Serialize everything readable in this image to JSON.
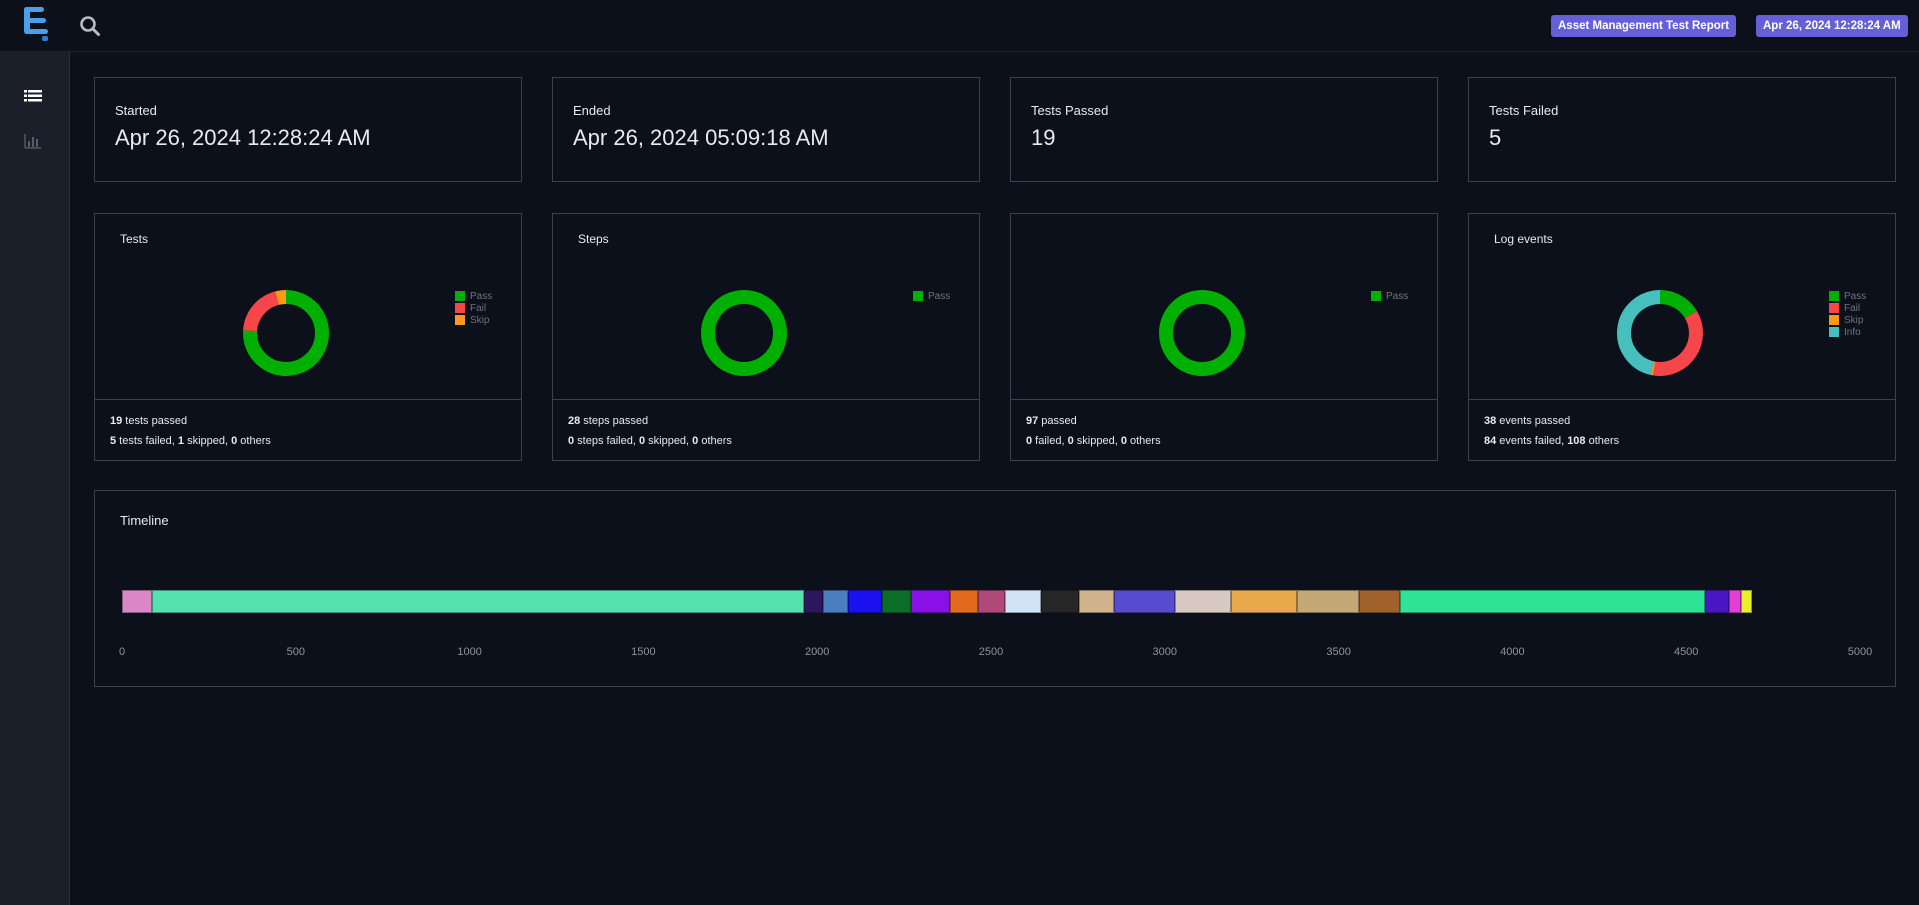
{
  "header": {
    "report_name": "Asset Management Test Report",
    "report_date": "Apr 26, 2024 12:28:24 AM",
    "logo_icon": "extent-logo-icon",
    "search_icon": "search-icon"
  },
  "sidebar": {
    "items": [
      {
        "icon": "list-icon"
      },
      {
        "icon": "bar-chart-icon"
      }
    ]
  },
  "summary_cards": {
    "started": {
      "label": "Started",
      "value": "Apr 26, 2024 12:28:24 AM"
    },
    "ended": {
      "label": "Ended",
      "value": "Apr 26, 2024 05:09:18 AM"
    },
    "passed": {
      "label": "Tests Passed",
      "value": "19"
    },
    "failed": {
      "label": "Tests Failed",
      "value": "5"
    }
  },
  "colors": {
    "pass": "#00b000",
    "fail": "#f7464a",
    "skip": "#fd9b16",
    "info": "#46bfbd",
    "accent": "#6660d8"
  },
  "charts": {
    "tests": {
      "title": "Tests",
      "legend": [
        "Pass",
        "Fail",
        "Skip"
      ],
      "line1": {
        "n1": "19",
        "t1": " tests passed"
      },
      "line2": {
        "n1": "5",
        "t1": " tests failed, ",
        "n2": "1",
        "t2": " skipped, ",
        "n3": "0",
        "t3": " others"
      }
    },
    "steps": {
      "title": "Steps",
      "legend": [
        "Pass"
      ],
      "line1": {
        "n1": "28",
        "t1": " steps passed"
      },
      "line2": {
        "n1": "0",
        "t1": " steps failed, ",
        "n2": "0",
        "t2": " skipped, ",
        "n3": "0",
        "t3": " others"
      }
    },
    "third": {
      "title": "",
      "legend": [
        "Pass"
      ],
      "line1": {
        "n1": "97",
        "t1": " passed"
      },
      "line2": {
        "n1": "0",
        "t1": " failed, ",
        "n2": "0",
        "t2": " skipped, ",
        "n3": "0",
        "t3": " others"
      }
    },
    "log_events": {
      "title": "Log events",
      "legend": [
        "Pass",
        "Fail",
        "Skip",
        "Info"
      ],
      "line1": {
        "n1": "38",
        "t1": " events passed"
      },
      "line2": {
        "n1": "84",
        "t1": " events failed, ",
        "n2": "108",
        "t2": " others"
      }
    }
  },
  "chart_data": [
    {
      "type": "pie",
      "categories": [
        "Pass",
        "Fail",
        "Skip"
      ],
      "values": [
        19,
        5,
        1
      ],
      "colors": [
        "#00b000",
        "#f7464a",
        "#fd9b16"
      ],
      "donut": true
    },
    {
      "type": "pie",
      "categories": [
        "Pass"
      ],
      "values": [
        28
      ],
      "colors": [
        "#00b000"
      ],
      "donut": true
    },
    {
      "type": "pie",
      "categories": [
        "Pass"
      ],
      "values": [
        97
      ],
      "colors": [
        "#00b000"
      ],
      "donut": true
    },
    {
      "type": "pie",
      "categories": [
        "Pass",
        "Fail",
        "Skip",
        "Info"
      ],
      "values": [
        38,
        84,
        2,
        108
      ],
      "colors": [
        "#00b000",
        "#f7464a",
        "#fd9b16",
        "#46bfbd"
      ],
      "donut": true
    },
    {
      "type": "bar",
      "title": "Timeline",
      "orientation": "horizontal-stacked",
      "x_ticks": [
        "0",
        "500",
        "1000",
        "1500",
        "2000",
        "2500",
        "3000",
        "3500",
        "4000",
        "4500",
        "5000"
      ],
      "xlim": [
        0,
        5000
      ],
      "segments": [
        {
          "start": 0,
          "end": 85,
          "color": "#d987c7"
        },
        {
          "start": 85,
          "end": 1963,
          "color": "#55e2b1"
        },
        {
          "start": 1963,
          "end": 2018,
          "color": "#2c165e"
        },
        {
          "start": 2018,
          "end": 2088,
          "color": "#4a7ebf"
        },
        {
          "start": 2088,
          "end": 2186,
          "color": "#1a10f0"
        },
        {
          "start": 2186,
          "end": 2270,
          "color": "#0b6e26"
        },
        {
          "start": 2270,
          "end": 2382,
          "color": "#8910e6"
        },
        {
          "start": 2382,
          "end": 2463,
          "color": "#e36a1c"
        },
        {
          "start": 2463,
          "end": 2540,
          "color": "#b0487a"
        },
        {
          "start": 2540,
          "end": 2645,
          "color": "#d1e3f6"
        },
        {
          "start": 2645,
          "end": 2752,
          "color": "#262626"
        },
        {
          "start": 2752,
          "end": 2855,
          "color": "#d2b48c"
        },
        {
          "start": 2855,
          "end": 3030,
          "color": "#574cd0"
        },
        {
          "start": 3030,
          "end": 3190,
          "color": "#d8c9c2"
        },
        {
          "start": 3190,
          "end": 3380,
          "color": "#e8a84c"
        },
        {
          "start": 3380,
          "end": 3558,
          "color": "#c4a878"
        },
        {
          "start": 3558,
          "end": 3677,
          "color": "#a0612a"
        },
        {
          "start": 3677,
          "end": 4555,
          "color": "#2fe396"
        },
        {
          "start": 4555,
          "end": 4622,
          "color": "#4a16c4"
        },
        {
          "start": 4622,
          "end": 4658,
          "color": "#e43ed6"
        },
        {
          "start": 4658,
          "end": 4688,
          "color": "#e9f02a"
        }
      ]
    }
  ],
  "timeline": {
    "title": "Timeline"
  }
}
